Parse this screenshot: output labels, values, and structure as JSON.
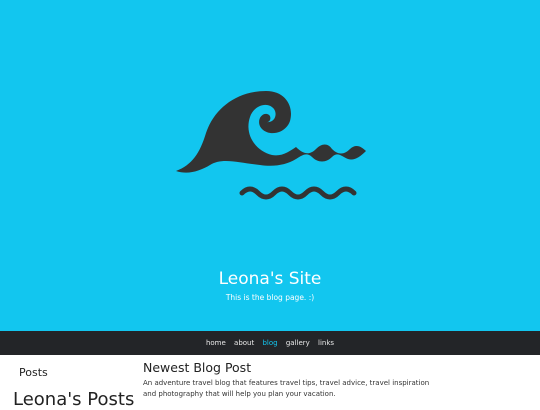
{
  "colors": {
    "hero_bg": "#12c6ef",
    "navbar_bg": "#232528",
    "nav_active": "#12c6ef",
    "logo_fill": "#333333"
  },
  "hero": {
    "logo_icon": "wave-icon",
    "title": "Leona's Site",
    "tagline": "This is the blog page. :)"
  },
  "nav": {
    "items": [
      {
        "label": "home"
      },
      {
        "label": "about"
      },
      {
        "label": "blog"
      },
      {
        "label": "gallery"
      },
      {
        "label": "links"
      }
    ],
    "active": "blog"
  },
  "sidebar": {
    "heading": "Posts",
    "title": "Leona's Posts"
  },
  "main": {
    "post_title": "Newest Blog Post",
    "post_description": "An adventure travel blog that features travel tips, travel advice, travel inspiration and photography that will help you plan your vacation."
  }
}
